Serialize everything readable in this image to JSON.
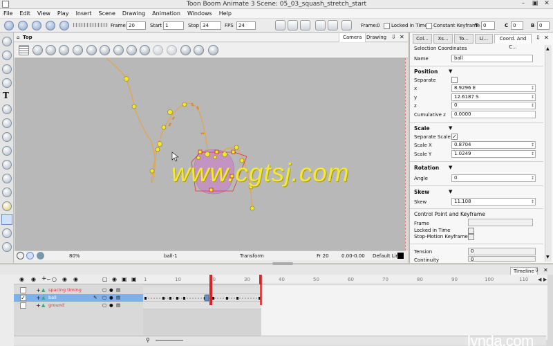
{
  "window": {
    "title": "Toon Boom Animate 3 Scene: 05_03_squash_stretch_start"
  },
  "menu": [
    "File",
    "Edit",
    "View",
    "Play",
    "Insert",
    "Scene",
    "Drawing",
    "Animation",
    "Windows",
    "Help"
  ],
  "playback": {
    "frame_label": "Frame",
    "frame_value": "20",
    "start_label": "Start",
    "start_value": "1",
    "stop_label": "Stop",
    "stop_value": "34",
    "fps_label": "FPS",
    "fps_value": "24"
  },
  "keyframe_bar": {
    "frame_label": "Frame:",
    "frame_value": "0",
    "locked_label": "Locked in Time",
    "constant_label": "Constant Keyframe",
    "t_label": "T",
    "t_value": "0",
    "c_label": "C",
    "c_value": "0",
    "b_label": "B",
    "b_value": "0"
  },
  "viewport": {
    "view_name": "Top",
    "tabs": [
      "Camera",
      "Drawing"
    ],
    "status": {
      "zoom": "80%",
      "drawing": "ball-1",
      "tool": "Transform",
      "frame": "Fr 20",
      "coords": "0.00-0.00",
      "line": "Default Line"
    }
  },
  "right_panel": {
    "tabs": [
      "Col...",
      "Xs...",
      "To...",
      "Li...",
      "Coord. And C..."
    ],
    "section_title": "Selection Coordinates",
    "name_label": "Name",
    "name_value": "ball",
    "position": {
      "heading": "Position",
      "separate_label": "Separate",
      "x_label": "x",
      "x_value": "8.9296 E",
      "y_label": "y",
      "y_value": "12.6187 S",
      "z_label": "z",
      "z_value": "0",
      "cumz_label": "Cumulative z",
      "cumz_value": "0.0000"
    },
    "scale": {
      "heading": "Scale",
      "separate_label": "Separate Scale",
      "sx_label": "Scale X",
      "sx_value": "0.8704",
      "sy_label": "Scale Y",
      "sy_value": "1.0249"
    },
    "rotation": {
      "heading": "Rotation",
      "angle_label": "Angle",
      "angle_value": "0"
    },
    "skew": {
      "heading": "Skew",
      "skew_label": "Skew",
      "skew_value": "11.108"
    },
    "control": {
      "heading": "Control Point and Keyframe",
      "frame_label": "Frame",
      "locked_label": "Locked in Time",
      "stop_label": "Stop-Motion Keyframe",
      "tension_label": "Tension",
      "tension_value": "0",
      "continuity_label": "Continuity",
      "continuity_value": "0"
    }
  },
  "timeline": {
    "title": "Timeline",
    "ruler_ticks": [
      "1",
      "10",
      "20",
      "30",
      "40",
      "50",
      "60",
      "70",
      "80",
      "90",
      "100",
      "110"
    ],
    "current_frame_marker": "20",
    "layers": [
      {
        "name": "spacing timing",
        "checked": false,
        "selected": false,
        "color": "#e05050"
      },
      {
        "name": "ball",
        "checked": true,
        "selected": true,
        "color": "#ffffff"
      },
      {
        "name": "ground",
        "checked": false,
        "selected": false,
        "color": "#e05050"
      }
    ]
  },
  "watermark": "www.cgtsj.com",
  "brand": "lynda.com",
  "colors": {
    "path": "#f0a030",
    "node": "#f2e62e",
    "ball": "#c58fc4",
    "selection": "#e03030",
    "accent": "#7fb0ea"
  }
}
